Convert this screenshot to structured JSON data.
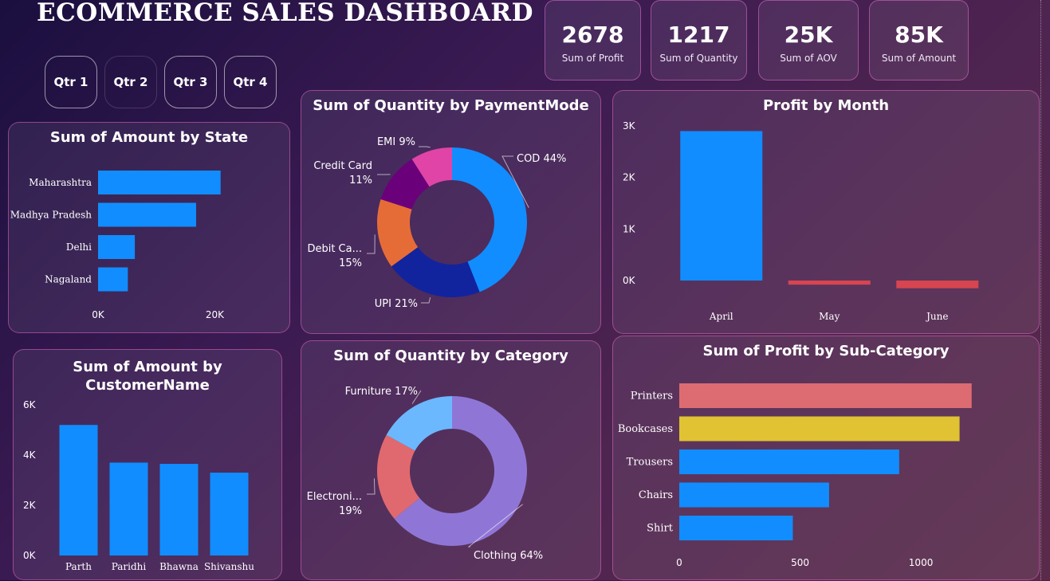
{
  "dashboard": {
    "title": "ECOMMERCE SALES DASHBOARD"
  },
  "quarters": [
    "Qtr 1",
    "Qtr 2",
    "Qtr 3",
    "Qtr 4"
  ],
  "kpis": [
    {
      "value": "2678",
      "label": "Sum of Profit"
    },
    {
      "value": "1217",
      "label": "Sum of Quantity"
    },
    {
      "value": "25K",
      "label": "Sum of AOV"
    },
    {
      "value": "85K",
      "label": "Sum of Amount"
    }
  ],
  "colors": {
    "bar": "#118dff",
    "negative": "#d64550",
    "upi": "#12239e",
    "debit": "#e66c37",
    "credit": "#6b007b",
    "emi": "#e044a7",
    "clothing": "#8f76d6",
    "electronics": "#e0696f",
    "furniture": "#6bb8ff",
    "printers": "#dd6b72",
    "bookcases": "#e0c233",
    "card_border": "#dc64be"
  },
  "chart_data": [
    {
      "type": "bar",
      "orientation": "horizontal",
      "title": "Sum of Amount by State",
      "categories": [
        "Maharashtra",
        "Madhya Pradesh",
        "Delhi",
        "Nagaland"
      ],
      "values": [
        21000,
        16800,
        6300,
        5100
      ],
      "xlim": [
        0,
        25000
      ],
      "xticks": [
        "0K",
        "20K"
      ],
      "xtick_values": [
        0,
        20000
      ]
    },
    {
      "type": "pie",
      "donut": true,
      "title": "Sum of Quantity by PaymentMode",
      "labels": [
        "COD",
        "UPI",
        "Debit Ca...",
        "Credit Card",
        "EMI"
      ],
      "values": [
        44,
        21,
        15,
        11,
        9
      ],
      "label_texts": [
        "COD 44%",
        "UPI 21%",
        "Debit Ca...",
        "Credit Card",
        "EMI 9%"
      ],
      "pct_texts": [
        "",
        "",
        "15%",
        "11%",
        ""
      ]
    },
    {
      "type": "bar",
      "title": "Profit by Month",
      "categories": [
        "April",
        "May",
        "June"
      ],
      "values": [
        2900,
        -80,
        -150
      ],
      "ylim": [
        -200,
        3000
      ],
      "yticks": [
        "0K",
        "1K",
        "2K",
        "3K"
      ],
      "ytick_values": [
        0,
        1000,
        2000,
        3000
      ]
    },
    {
      "type": "bar",
      "title": "Sum of Amount by CustomerName",
      "categories": [
        "Parth",
        "Paridhi",
        "Bhawna",
        "Shivanshu"
      ],
      "values": [
        5200,
        3700,
        3650,
        3300
      ],
      "ylim": [
        0,
        6000
      ],
      "yticks": [
        "0K",
        "2K",
        "4K",
        "6K"
      ],
      "ytick_values": [
        0,
        2000,
        4000,
        6000
      ]
    },
    {
      "type": "pie",
      "donut": true,
      "title": "Sum of Quantity by Category",
      "labels": [
        "Clothing",
        "Electroni...",
        "Furniture"
      ],
      "values": [
        64,
        19,
        17
      ],
      "label_texts": [
        "Clothing 64%",
        "Electroni...",
        "Furniture 17%"
      ],
      "pct_texts": [
        "",
        "19%",
        ""
      ]
    },
    {
      "type": "bar",
      "orientation": "horizontal",
      "title": "Sum of Profit by Sub-Category",
      "categories": [
        "Printers",
        "Bookcases",
        "Trousers",
        "Chairs",
        "Shirt"
      ],
      "values": [
        1210,
        1160,
        910,
        620,
        470
      ],
      "xlim": [
        0,
        1300
      ],
      "xticks": [
        "0",
        "500",
        "1000"
      ],
      "xtick_values": [
        0,
        500,
        1000
      ]
    }
  ]
}
